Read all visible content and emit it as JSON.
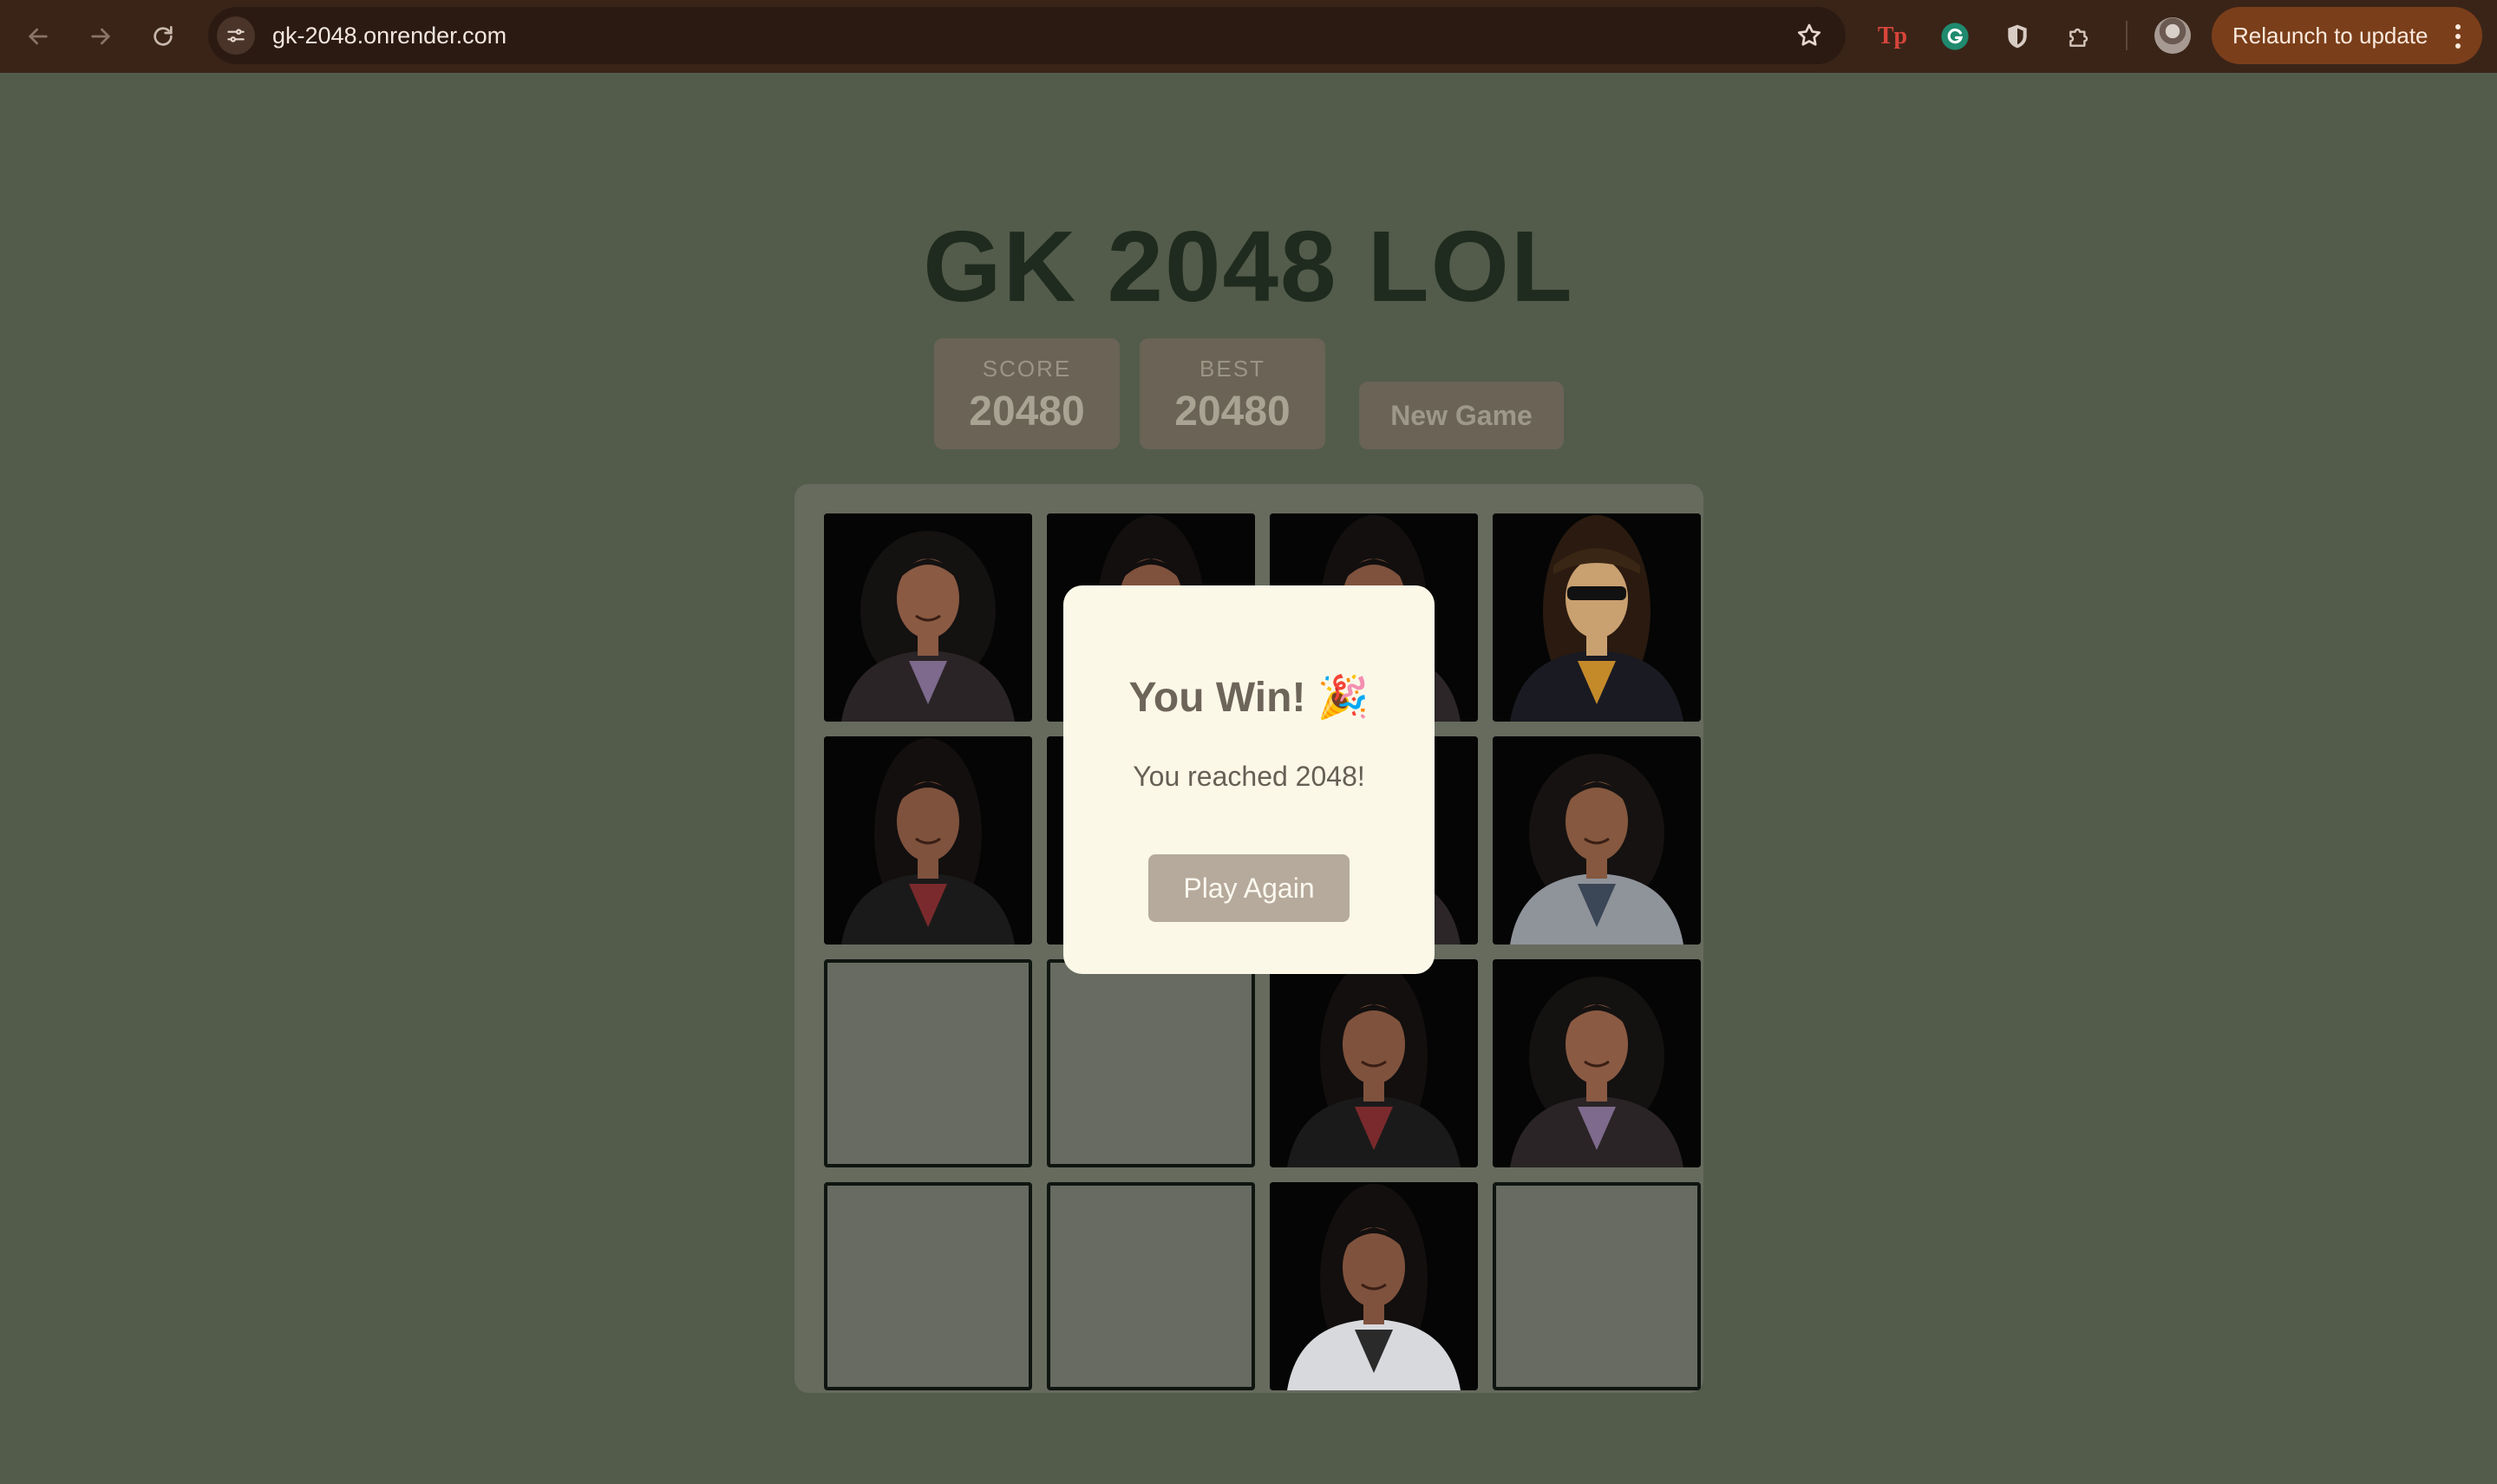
{
  "browser": {
    "url": "gk-2048.onrender.com",
    "relaunch_label": "Relaunch to update",
    "extension_tp_label": "Tp"
  },
  "game": {
    "title": "GK 2048 LOL",
    "score_label": "SCORE",
    "score_value": "20480",
    "best_label": "BEST",
    "best_value": "20480",
    "new_game_label": "New Game"
  },
  "board": {
    "size": 4,
    "tiles": [
      [
        "photo-curly-hair-smiling",
        "photo-long-hair",
        "photo-long-hair",
        "photo-sunglasses-man"
      ],
      [
        "photo-long-hair-jacket",
        "photo-long-hair",
        "photo-long-hair",
        "photo-curly-hair-grey-jacket"
      ],
      [
        "empty",
        "empty",
        "photo-long-hair-jacket",
        "photo-curly-hair-smiling"
      ],
      [
        "empty",
        "empty",
        "photo-long-hair-white-top",
        "empty"
      ]
    ]
  },
  "overlay": {
    "title": "You Win! 🎉",
    "message": "You reached 2048!",
    "button_label": "Play Again"
  },
  "colors": {
    "page_background": "#535c4b",
    "title": "#1f2b1e",
    "overlay_background": "#fbf8e8",
    "button": "#b6aa9c",
    "chrome": "#3a2418",
    "relaunch": "#7a3e1a"
  }
}
